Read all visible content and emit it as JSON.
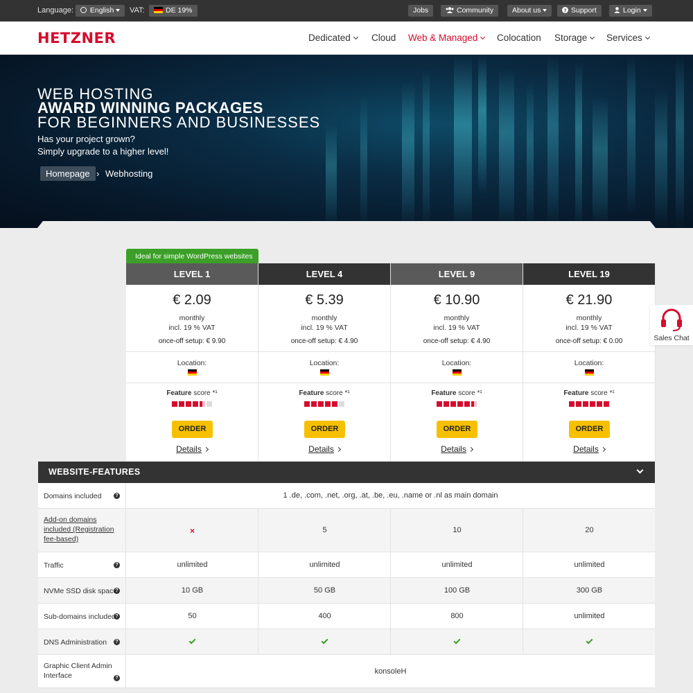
{
  "topbar": {
    "language_label": "Language:",
    "language_value": "English",
    "vat_label": "VAT:",
    "vat_value": "DE 19%",
    "links": [
      "Jobs",
      "Community",
      "About us",
      "Support",
      "Login"
    ]
  },
  "header": {
    "logo": "HETZNER",
    "nav": [
      "Dedicated",
      "Cloud",
      "Web & Managed",
      "Colocation",
      "Storage",
      "Services"
    ],
    "active_nav": "Web & Managed",
    "brand_color": "#d50c2d"
  },
  "hero": {
    "line1": "WEB HOSTING",
    "line2": "AWARD WINNING PACKAGES",
    "line3": "FOR BEGINNERS AND BUSINESSES",
    "para1": "Has your project grown?",
    "para2": "Simply upgrade to a higher level!",
    "breadcrumb_home": "Homepage",
    "breadcrumb_current": "Webhosting"
  },
  "pricing": {
    "ribbon": "Ideal for simple WordPress websites",
    "location_label": "Location:",
    "feature_score_bold": "Feature",
    "feature_score_rest": "score *¹",
    "order_label": "ORDER",
    "details_label": "Details",
    "plans": [
      {
        "name": "LEVEL 1",
        "price": "€ 2.09",
        "monthly": "monthly",
        "vat": "incl. 19 % VAT",
        "setup": "once-off setup: € 9.90",
        "score": 4.5,
        "header_color": "#5a5a5a"
      },
      {
        "name": "LEVEL 4",
        "price": "€ 5.39",
        "monthly": "monthly",
        "vat": "incl. 19 % VAT",
        "setup": "once-off setup: € 4.90",
        "score": 5,
        "header_color": "#333333"
      },
      {
        "name": "LEVEL 9",
        "price": "€ 10.90",
        "monthly": "monthly",
        "vat": "incl. 19 % VAT",
        "setup": "once-off setup: € 4.90",
        "score": 5.5,
        "header_color": "#5a5a5a"
      },
      {
        "name": "LEVEL 19",
        "price": "€ 21.90",
        "monthly": "monthly",
        "vat": "incl. 19 % VAT",
        "setup": "once-off setup: € 0.00",
        "score": 6,
        "header_color": "#333333"
      }
    ]
  },
  "sales_chat": {
    "label": "Sales Chat"
  },
  "features": {
    "title": "WEBSITE-FEATURES",
    "rows": [
      {
        "label": "Domains included",
        "span": "1 .de, .com, .net, .org, .at, .be, .eu, .name or .nl as main domain"
      },
      {
        "label": "Add-on domains included (Registration fee-based)",
        "values": [
          "x",
          "5",
          "10",
          "20"
        ]
      },
      {
        "label": "Traffic",
        "values": [
          "unlimited",
          "unlimited",
          "unlimited",
          "unlimited"
        ]
      },
      {
        "label": "NVMe SSD disk space",
        "values": [
          "10 GB",
          "50 GB",
          "100 GB",
          "300 GB"
        ]
      },
      {
        "label": "Sub-domains included",
        "values": [
          "50",
          "400",
          "800",
          "unlimited"
        ]
      },
      {
        "label": "DNS Administration",
        "values": [
          "check",
          "check",
          "check",
          "check"
        ]
      },
      {
        "label": "Graphic Client Admin Interface",
        "span": "konsoleH"
      }
    ]
  }
}
